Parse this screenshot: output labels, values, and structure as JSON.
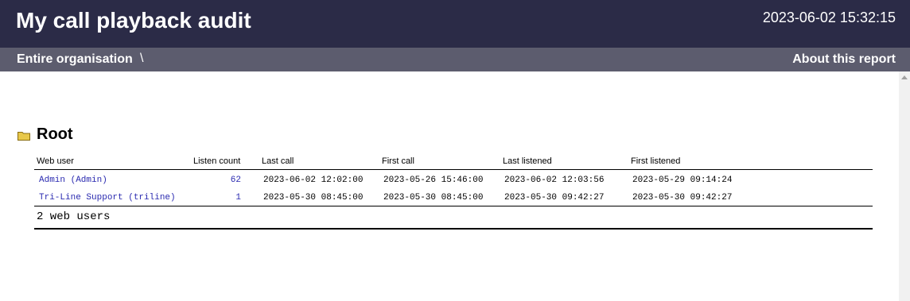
{
  "header": {
    "title": "My call playback audit",
    "timestamp": "2023-06-02 15:32:15"
  },
  "nav": {
    "breadcrumb": "Entire organisation",
    "separator": "\\",
    "about_link": "About this report"
  },
  "section": {
    "title": "Root",
    "icon": "folder-icon"
  },
  "table": {
    "columns": [
      "Web user",
      "Listen count",
      "Last call",
      "First call",
      "Last listened",
      "First listened"
    ],
    "rows": [
      {
        "web_user": "Admin (Admin)",
        "listen_count": "62",
        "last_call": "2023-06-02 12:02:00",
        "first_call": "2023-05-26 15:46:00",
        "last_listened": "2023-06-02 12:03:56",
        "first_listened": "2023-05-29 09:14:24"
      },
      {
        "web_user": "Tri-Line Support (triline)",
        "listen_count": "1",
        "last_call": "2023-05-30 08:45:00",
        "first_call": "2023-05-30 08:45:00",
        "last_listened": "2023-05-30 09:42:27",
        "first_listened": "2023-05-30 09:42:27"
      }
    ],
    "summary": "2 web users"
  },
  "colors": {
    "header_bg": "#2b2b47",
    "nav_bg": "#5c5c6e",
    "link": "#2a2ab0",
    "folder": "#e8c84a"
  }
}
